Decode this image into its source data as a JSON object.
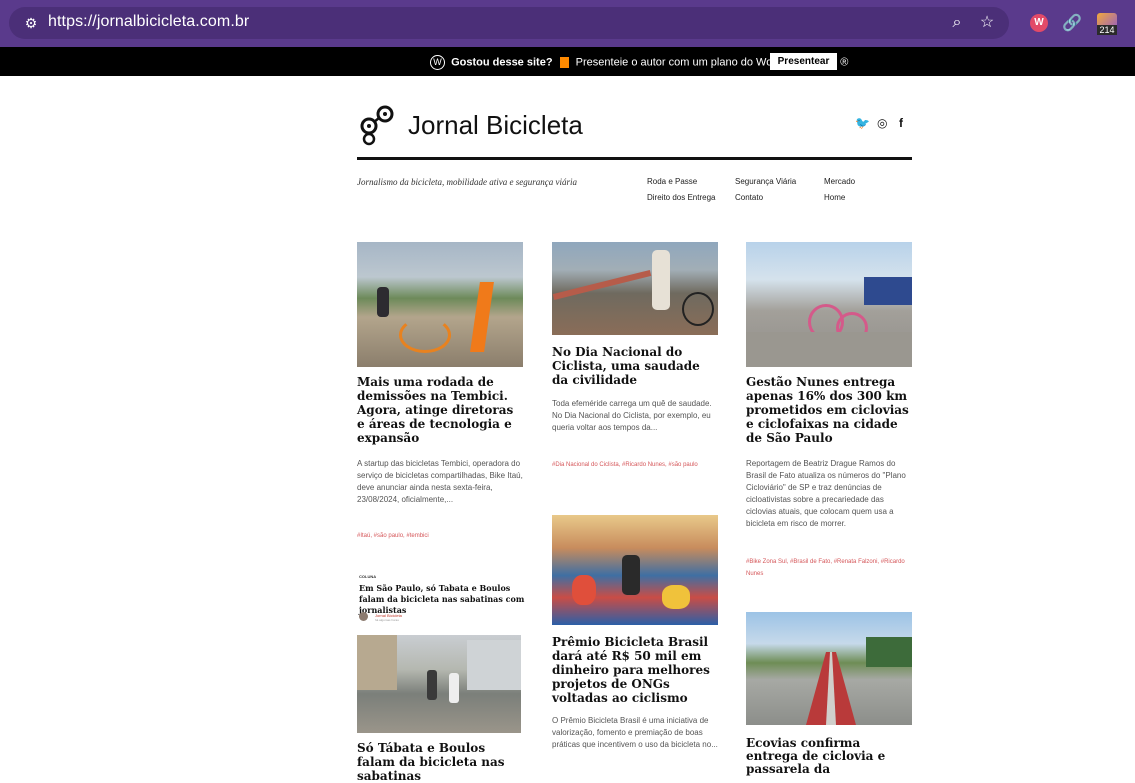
{
  "browser": {
    "url": "https://jornalbicicleta.com.br",
    "ext_badge_count": "214",
    "ext_red_label": "W"
  },
  "wpbar": {
    "logo_glyph": "W",
    "prompt_bold": "Gostou desse site?",
    "prompt_text": "Presenteie o autor com um plano do WordPress.com.",
    "info_glyph": "®",
    "button_label": "Presentear"
  },
  "site": {
    "title": "Jornal Bicicleta",
    "tagline": "Jornalismo da bicicleta, mobilidade ativa e segurança viária",
    "social": {
      "twitter": "🐦",
      "instagram": "◎",
      "facebook": "f"
    },
    "nav": [
      "Roda e Passe",
      "Segurança Viária",
      "Mercado",
      "Direito dos Entrega",
      "Contato",
      "Home"
    ]
  },
  "posts": {
    "p1": {
      "title": "Mais uma rodada de demissões na Tembici. Agora, atinge diretoras e áreas de tecnologia e expansão",
      "excerpt": "A startup das bicicletas Tembici, operadora do serviço de bicicletas compartilhadas, Bike Itaú, deve anunciar ainda nesta sexta-feira, 23/08/2024, oficialmente,...",
      "tags": "#Itaú, #são paulo, #tembici"
    },
    "p2": {
      "title": "No Dia Nacional do Ciclista, uma saudade da civilidade",
      "excerpt": "Toda efeméride carrega um quê de saudade. No Dia Nacional do Ciclista, por exemplo, eu queria voltar aos tempos da...",
      "tags": "#Dia Nacional do Ciclista, #Ricardo Nunes, #são paulo"
    },
    "p3": {
      "title": "Gestão Nunes entrega apenas 16% dos 300 km prometidos em ciclovias e ciclofaixas na cidade de São Paulo",
      "excerpt": "Reportagem de Beatriz Drague Ramos do Brasil de Fato atualiza os números do \"Plano Cicloviário\" de SP e traz denúncias de cicloativistas sobre a precariedade das ciclovias atuais, que colocam quem usa a bicicleta em risco de morrer.",
      "tags": "#Bike Zona Sul, #Brasil de Fato, #Renata Falzoni, #Ricardo Nunes"
    },
    "mini": {
      "kicker": "COLUNA",
      "title": "Em São Paulo, só Tabata e Boulos falam da bicicleta nas sabatinas com jornalistas",
      "author": "Jornal Bicicleta",
      "author_sub": "há algumas horas"
    },
    "p4": {
      "title": "Só Tábata e Boulos falam da bicicleta nas sabatinas"
    },
    "p5": {
      "title": "Prêmio Bicicleta Brasil dará até R$ 50 mil em dinheiro para melhores projetos de ONGs voltadas ao ciclismo",
      "excerpt": "O Prêmio Bicicleta Brasil é uma iniciativa de valorização, fomento e premiação de boas práticas que incentivem o uso da bicicleta no..."
    },
    "p6": {
      "title": "Ecovias confirma entrega de ciclovia e passarela da"
    }
  }
}
